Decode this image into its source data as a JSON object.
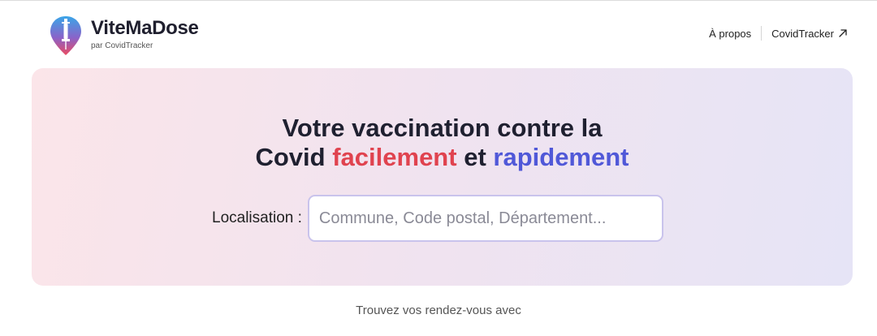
{
  "header": {
    "logo_title": "ViteMaDose",
    "logo_subtitle": "par CovidTracker",
    "nav": {
      "about_label": "À propos",
      "covidtracker_label": "CovidTracker"
    }
  },
  "hero": {
    "title_line1": "Votre vaccination contre la",
    "title_word_covid": "Covid",
    "title_word_facilement": "facilement",
    "title_word_et": "et",
    "title_word_rapidement": "rapidement",
    "search": {
      "label": "Localisation :",
      "placeholder": "Commune, Code postal, Département...",
      "value": ""
    }
  },
  "footer": {
    "text": "Trouvez vos rendez-vous avec"
  },
  "colors": {
    "accent_red": "#e0434f",
    "accent_blue": "#5058d8",
    "input_border": "#c9c3ec"
  },
  "icons": {
    "logo": "syringe-pin-icon",
    "external_link": "arrow-up-right-icon"
  }
}
